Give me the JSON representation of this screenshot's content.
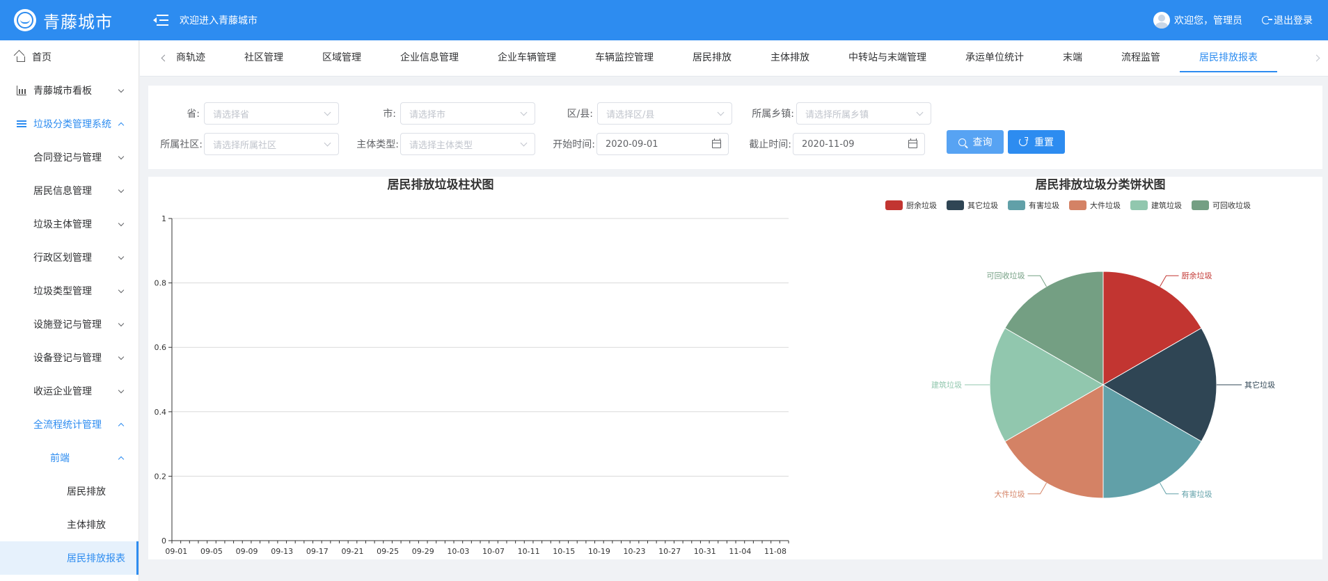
{
  "header": {
    "app_title": "青藤城市",
    "welcome": "欢迎进入青藤城市",
    "user_greeting": "欢迎您，管理员",
    "logout_label": "退出登录",
    "bg_color": "#2d8cf0"
  },
  "sidebar": {
    "items": [
      {
        "label": "首页",
        "level": 0,
        "icon": "home-icon"
      },
      {
        "label": "青藤城市看板",
        "level": 0,
        "icon": "bar-chart-icon",
        "chevron": "down"
      },
      {
        "label": "垃圾分类管理系统",
        "level": 0,
        "icon": "list-icon",
        "chevron": "up",
        "active": true
      },
      {
        "label": "合同登记与管理",
        "level": 1,
        "chevron": "down"
      },
      {
        "label": "居民信息管理",
        "level": 1,
        "chevron": "down"
      },
      {
        "label": "垃圾主体管理",
        "level": 1,
        "chevron": "down"
      },
      {
        "label": "行政区划管理",
        "level": 1,
        "chevron": "down"
      },
      {
        "label": "垃圾类型管理",
        "level": 1,
        "chevron": "down"
      },
      {
        "label": "设施登记与管理",
        "level": 1,
        "chevron": "down"
      },
      {
        "label": "设备登记与管理",
        "level": 1,
        "chevron": "down"
      },
      {
        "label": "收运企业管理",
        "level": 1,
        "chevron": "down"
      },
      {
        "label": "全流程统计管理",
        "level": 1,
        "chevron": "up",
        "active": true
      },
      {
        "label": "前端",
        "level": 2,
        "chevron": "up",
        "active": true
      },
      {
        "label": "居民排放",
        "level": 3
      },
      {
        "label": "主体排放",
        "level": 3
      },
      {
        "label": "居民排放报表",
        "level": 3,
        "selected": true
      }
    ]
  },
  "tabs": {
    "items": [
      "商轨迹",
      "社区管理",
      "区域管理",
      "企业信息管理",
      "企业车辆管理",
      "车辆监控管理",
      "居民排放",
      "主体排放",
      "中转站与末端管理",
      "承运单位统计",
      "末端",
      "流程监管",
      "居民排放报表"
    ],
    "active_index": 12
  },
  "filters": {
    "province": {
      "label": "省:",
      "placeholder": "请选择省"
    },
    "city": {
      "label": "市:",
      "placeholder": "请选择市"
    },
    "district": {
      "label": "区/县:",
      "placeholder": "请选择区/县"
    },
    "town": {
      "label": "所属乡镇:",
      "placeholder": "请选择所属乡镇"
    },
    "community": {
      "label": "所属社区:",
      "placeholder": "请选择所属社区"
    },
    "subject_type": {
      "label": "主体类型:",
      "placeholder": "请选择主体类型"
    },
    "start_time": {
      "label": "开始时间:",
      "value": "2020-09-01"
    },
    "end_time": {
      "label": "截止时间:",
      "value": "2020-11-09"
    },
    "query_label": "查询",
    "reset_label": "重置"
  },
  "chart_data": [
    {
      "type": "bar",
      "title": "居民排放垃圾柱状图",
      "categories": [
        "09-01",
        "09-05",
        "09-09",
        "09-13",
        "09-17",
        "09-21",
        "09-25",
        "09-29",
        "10-03",
        "10-07",
        "10-11",
        "10-15",
        "10-19",
        "10-23",
        "10-27",
        "10-31",
        "11-04",
        "11-08"
      ],
      "yticks": [
        "0",
        "0.2",
        "0.4",
        "0.6",
        "0.8",
        "1"
      ],
      "ylim": [
        0,
        1
      ],
      "grid": true,
      "series": []
    },
    {
      "type": "pie",
      "title": "居民排放垃圾分类饼状图",
      "legend_position": "top",
      "slices": [
        {
          "name": "厨余垃圾",
          "value": 1,
          "color": "#c23531"
        },
        {
          "name": "其它垃圾",
          "value": 1,
          "color": "#2f4554"
        },
        {
          "name": "有害垃圾",
          "value": 1,
          "color": "#61a0a8"
        },
        {
          "name": "大件垃圾",
          "value": 1,
          "color": "#d48265"
        },
        {
          "name": "建筑垃圾",
          "value": 1,
          "color": "#91c7ae"
        },
        {
          "name": "可回收垃圾",
          "value": 1,
          "color": "#749f83"
        }
      ]
    }
  ]
}
